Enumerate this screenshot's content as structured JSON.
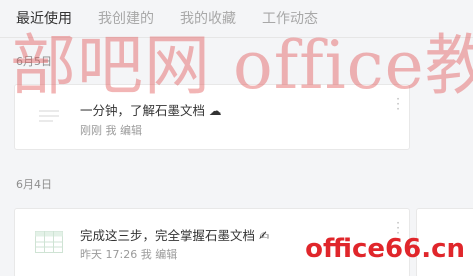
{
  "tabs": [
    {
      "label": "最近使用"
    },
    {
      "label": "我创建的"
    },
    {
      "label": "我的收藏"
    },
    {
      "label": "工作动态"
    }
  ],
  "groups": [
    {
      "date": "6月5日",
      "files": [
        {
          "title": "一分钟，了解石墨文档",
          "title_emoji": "☁",
          "meta": "刚刚 我 编辑",
          "type": "doc"
        }
      ]
    },
    {
      "date": "6月4日",
      "files": [
        {
          "title": "完成这三步，完全掌握石墨文档",
          "title_emoji": "✍",
          "meta": "昨天 17:26 我 编辑",
          "type": "sheet"
        }
      ]
    }
  ],
  "watermark": {
    "text": "部吧网 office教程网",
    "logo": "office66.cn"
  },
  "colors": {
    "background": "#f4f5f7",
    "card": "#ffffff",
    "active_tab": "#333333",
    "inactive_tab": "#a8a8a8",
    "meta": "#9a9a9a",
    "sheet_green": "#5bbb74",
    "watermark_red": "#e0262b"
  }
}
